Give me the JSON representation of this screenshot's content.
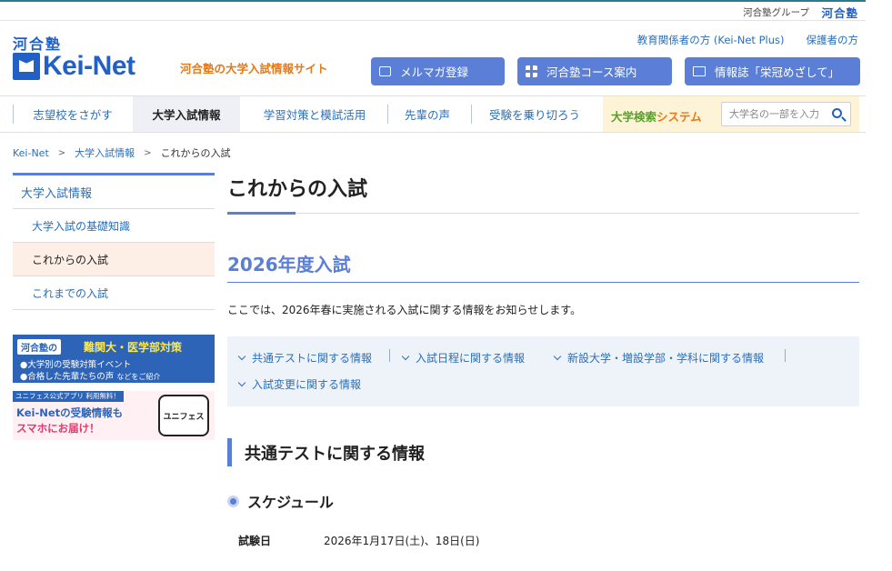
{
  "group": {
    "label": "河合塾グループ",
    "logo": "河合塾"
  },
  "header": {
    "kawai": "河合塾",
    "brand": "Kei-Net",
    "tagline": "河合塾の大学入試情報サイト",
    "util_links": [
      "教育関係者の方 (Kei-Net Plus)",
      "保護者の方"
    ],
    "buttons": [
      {
        "label": "メルマガ登録",
        "icon": "mail-icon"
      },
      {
        "label": "河合塾コース案内",
        "icon": "grid-icon"
      },
      {
        "label": "情報誌「栄冠めざして」",
        "icon": "book-icon"
      }
    ]
  },
  "gnav": {
    "items": [
      "志望校をさがす",
      "大学入試情報",
      "学習対策と模試活用",
      "先輩の声",
      "受験を乗り切ろう"
    ],
    "active_index": 1,
    "search_label_a": "大学検索",
    "search_label_b": "システム",
    "search_placeholder": "大学名の一部を入力"
  },
  "breadcrumb": [
    "Kei-Net",
    "大学入試情報",
    "これからの入試"
  ],
  "sidebar": {
    "heading": "大学入試情報",
    "items": [
      "大学入試の基礎知識",
      "これからの入試",
      "これまでの入試"
    ],
    "current_index": 1
  },
  "banners": {
    "b1_tag": "河合塾の",
    "b1_title": "難関大・医学部対策",
    "b1_line1": "●大学別の受験対策イベント",
    "b1_line2": "●合格した先輩たちの声",
    "b1_line2_small": "などをご紹介",
    "b2_top": "ユニフェス公式アプリ 利用無料！",
    "b2_line1": "Kei-Netの受験情報も",
    "b2_line2": "スマホにお届け！",
    "b2_app": "ユニフェス"
  },
  "main": {
    "title": "これからの入試",
    "section": "2026年度入試",
    "intro": "ここでは、2026年春に実施される入試に関する情報をお知らせします。",
    "jump_links": [
      "共通テストに関する情報",
      "入試日程に関する情報",
      "新設大学・増設学部・学科に関する情報",
      "入試変更に関する情報"
    ],
    "h3": "共通テストに関する情報",
    "h4": "スケジュール",
    "schedule": {
      "key": "試験日",
      "value": "2026年1月17日(土)、18日(日)"
    }
  },
  "colors": {
    "accent": "#5b7fd6",
    "brand": "#2160c4",
    "link": "#2a6fb8",
    "orange": "#e7791a"
  }
}
